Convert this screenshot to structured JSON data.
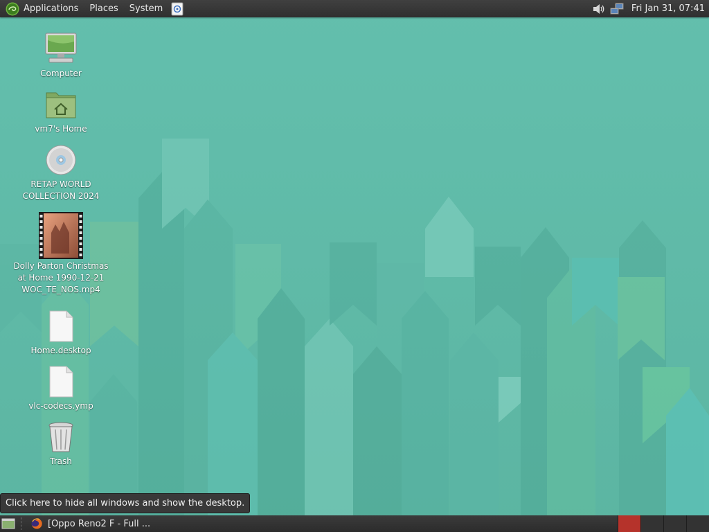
{
  "top_panel": {
    "menus": [
      "Applications",
      "Places",
      "System"
    ],
    "clock": "Fri Jan 31, 07:41"
  },
  "icons": {
    "app_logo": "opensuse-logo-icon",
    "launcher": "note-launcher-icon",
    "volume": "speaker-icon",
    "network": "network-icon",
    "show_desktop": "show-desktop-icon",
    "firefox": "firefox-icon"
  },
  "desktop": {
    "icons": [
      {
        "label": "Computer",
        "icon": "computer-icon"
      },
      {
        "label": "vm7's Home",
        "icon": "home-folder-icon"
      },
      {
        "label_lines": [
          "RETAP WORLD",
          "COLLECTION 2024"
        ],
        "icon": "disc-icon"
      },
      {
        "label_lines": [
          "Dolly Parton Christmas",
          "at Home 1990-12-21",
          "WOC_TE_NOS.mp4"
        ],
        "icon": "video-thumbnail-icon"
      },
      {
        "label": "Home.desktop",
        "icon": "file-icon"
      },
      {
        "label": "vlc-codecs.ymp",
        "icon": "file-icon"
      },
      {
        "label": "Trash",
        "icon": "trash-icon"
      }
    ]
  },
  "tooltip": "Click here to hide all windows and show the desktop.",
  "taskbar": {
    "task_label": "[Oppo Reno2 F - Full ...",
    "workspaces_count": 4,
    "active_workspace": 1
  },
  "colors": {
    "wallpaper": "#63bdaa",
    "panel": "#333333",
    "active_workspace": "#b5332b"
  }
}
